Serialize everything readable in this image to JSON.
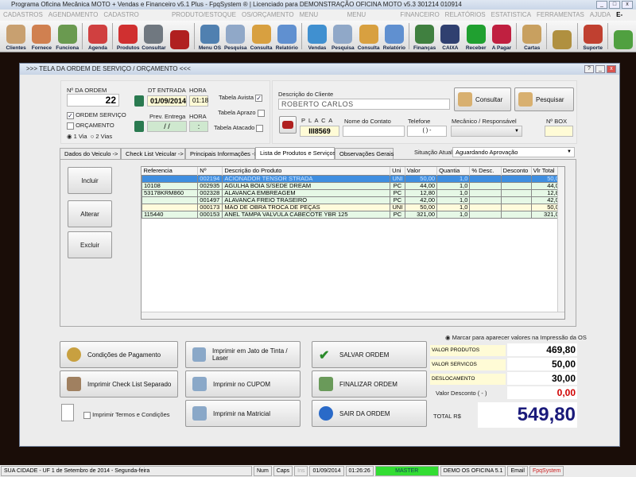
{
  "app": {
    "title": "Programa Oficina Mecânica MOTO + Vendas e Financeiro v5.1 Plus - FpqSystem ® | Licenciado para  DEMONSTRAÇÃO OFICINA MOTO v5.3 301214 010914"
  },
  "menu": [
    "CADASTROS",
    "AGENDAMENTO",
    "CADASTRO VEICULOS",
    "PRODUTO/ESTOQUE",
    "OS/ORÇAMENTO",
    "MENU VENDAS",
    "MENU COMPRAS",
    "FINANCEIRO",
    "RELATÓRIOS",
    "ESTATISTICA",
    "FERRAMENTAS",
    "AJUDA",
    "E-MAIL"
  ],
  "toolbar": [
    {
      "label": "Clientes",
      "color": "#c8a070"
    },
    {
      "label": "Fornece",
      "color": "#d08050"
    },
    {
      "label": "Funciona",
      "color": "#6a9a50"
    },
    {
      "label": "Agenda",
      "color": "#d04040"
    },
    {
      "label": "Produtos",
      "color": "#d03030"
    },
    {
      "label": "Consultar",
      "color": "#707880"
    },
    {
      "label": "",
      "color": "#b02020"
    },
    {
      "label": "Menu OS",
      "color": "#5080b0"
    },
    {
      "label": "Pesquisa",
      "color": "#90a8c8"
    },
    {
      "label": "Consulta",
      "color": "#d8a040"
    },
    {
      "label": "Relatório",
      "color": "#6090d0"
    },
    {
      "label": "Vendas",
      "color": "#4090d0"
    },
    {
      "label": "Pesquisa",
      "color": "#90a8c8"
    },
    {
      "label": "Consulta",
      "color": "#d8a040"
    },
    {
      "label": "Relatório",
      "color": "#6090d0"
    },
    {
      "label": "Finanças",
      "color": "#408040"
    },
    {
      "label": "CAIXA",
      "color": "#304070"
    },
    {
      "label": "Receber",
      "color": "#20a030"
    },
    {
      "label": "A Pagar",
      "color": "#c02040"
    },
    {
      "label": "Cartas",
      "color": "#c8a060"
    },
    {
      "label": "",
      "color": "#b09040"
    },
    {
      "label": "Suporte",
      "color": "#c04030"
    },
    {
      "label": "",
      "color": "#50a040"
    }
  ],
  "window": {
    "title": ">>>  TELA DA ORDEM DE SERVIÇO / ORÇAMENTO  <<<"
  },
  "order": {
    "number_label": "Nº DA ORDEM",
    "number": "22",
    "ordem_servico": "ORDEM SERVIÇO",
    "ordem_servico_checked": true,
    "orcamento": "ORÇAMENTO",
    "orcamento_checked": false,
    "via1": "1 Via",
    "via2": "2 Vias",
    "dt_entrada_label": "DT ENTRADA",
    "dt_entrada": "01/09/2014",
    "hora_label": "HORA",
    "hora": "01:18",
    "prev_label": "Prev. Entrega",
    "prev": "/ /",
    "hora2_label": "HORA",
    "hora2": ":",
    "tabela_avista": "Tabela Avista",
    "tabela_aprazo": "Tabela Aprazo",
    "tabela_atacado": "Tabela Atacado"
  },
  "client": {
    "desc_label": "Descrição do Cliente",
    "name": "ROBERTO CARLOS",
    "consultar": "Consultar",
    "pesquisar": "Pesquisar",
    "placa_label": "P L A C A",
    "placa": "III8569",
    "contato_label": "Nome do Contato",
    "contato": "",
    "telefone_label": "Telefone",
    "telefone": "(  )   -",
    "mecanico_label": "Mecânico / Responsável",
    "mecanico": "",
    "box_label": "Nº BOX",
    "box": ""
  },
  "tabs": [
    "Dados do Veiculo ->",
    "Check List Veicular ->",
    "Principais Informações ->",
    "Lista de Produtos e Serviços ->",
    "Observações Gerais"
  ],
  "situacao": {
    "label": "Situação Atual:",
    "value": "Aguardando Aprovação"
  },
  "actions": {
    "incluir": "Incluir",
    "alterar": "Alterar",
    "excluir": "Excluir"
  },
  "grid": {
    "columns": [
      "Referencia",
      "Nº",
      "Descrição do Produto",
      "Uni",
      "Valor",
      "Quantia",
      "% Desc.",
      "Desconto",
      "Vlr Total"
    ],
    "rows": [
      [
        "",
        "002194",
        "ACIONADOR TENSOR STRADA",
        "UNI",
        "50,00",
        "1,0",
        "",
        "",
        "50,00"
      ],
      [
        "10108",
        "002935",
        "AGULHA BOIA S/SEDE DREAM",
        "PC",
        "44,00",
        "1,0",
        "",
        "",
        "44,00"
      ],
      [
        "53178KRM860",
        "002328",
        "ALAVANCA EMBREAGEM",
        "PC",
        "12,80",
        "1,0",
        "",
        "",
        "12,80"
      ],
      [
        "",
        "001497",
        "ALAVANCA FREIO TRASEIRO",
        "PC",
        "42,00",
        "1,0",
        "",
        "",
        "42,00"
      ],
      [
        "",
        "000173",
        "MAO DE OBRA TROCA DE PEÇAS",
        "UNI",
        "50,00",
        "1,0",
        "",
        "",
        "50,00"
      ],
      [
        "115440",
        "000153",
        "ANEL TAMPA VALVULA CABECOTE YBR 125",
        "PC",
        "321,00",
        "1,0",
        "",
        "",
        "321,00"
      ]
    ]
  },
  "bottom": {
    "cond_pag": "Condições de Pagamento",
    "imp_check": "Imprimir Check List Separado",
    "imp_termos": "Imprimir Termos e Condições",
    "imp_jato": "Imprimir em Jato de Tinta / Laser",
    "imp_cupom": "Imprimir no CUPOM",
    "imp_matricial": "Imprimir na Matricial",
    "salvar": "SALVAR ORDEM",
    "finalizar": "FINALIZAR ORDEM",
    "sair": "SAIR DA ORDEM"
  },
  "totals": {
    "marcar": "Marcar para aparecer valores na Impressão da OS",
    "produtos_label": "VALOR PRODUTOS",
    "produtos": "469,80",
    "servicos_label": "VALOR SERVICOS",
    "servicos": "50,00",
    "desloc_label": "DESLOCAMENTO",
    "desloc": "30,00",
    "desconto_label": "Valor Desconto ( - )",
    "desconto": "0,00",
    "total_label": "TOTAL R$",
    "total": "549,80"
  },
  "status": {
    "city": "SUA CIDADE - UF  1 de Setembro de 2014 - Segunda-feira",
    "num": "Num",
    "caps": "Caps",
    "ins": "Ins",
    "date": "01/09/2014",
    "time": "01:26:26",
    "user": "MASTER",
    "demo": "DEMO OS OFICINA 5.1",
    "email": "Email",
    "brand": "FpqSystem"
  }
}
